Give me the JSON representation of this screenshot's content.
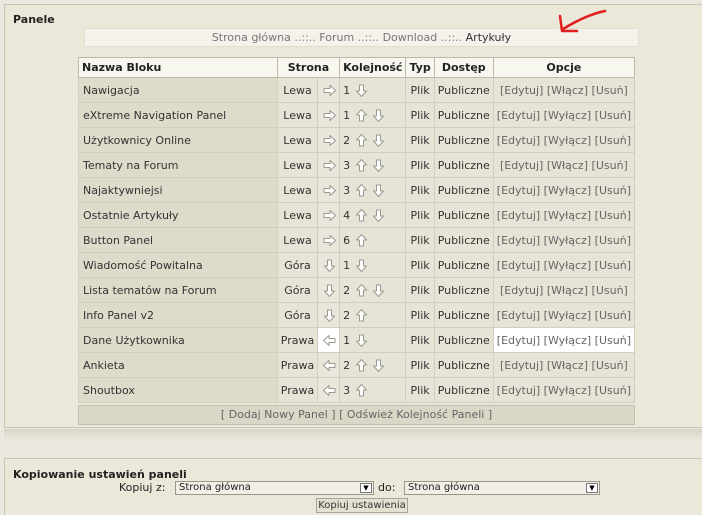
{
  "panel": {
    "title": "Panele"
  },
  "breadcrumb": {
    "home": "Strona główna",
    "sep1": "..::..",
    "forum": "Forum",
    "sep2": "..::..",
    "download": "Download",
    "sep3": "..::..",
    "current": "Artykuły"
  },
  "table": {
    "headers": {
      "name": "Nazwa Bloku",
      "side": "Strona",
      "order": "Kolejność",
      "type": "Typ",
      "access": "Dostęp",
      "options": "Opcje"
    },
    "rows": [
      {
        "name": "Nawigacja",
        "side": "Lewa",
        "move": "right",
        "order": "1",
        "up": false,
        "down": true,
        "type": "Plik",
        "access": "Publiczne",
        "edit": "Edytuj",
        "toggle": "Włącz",
        "delete": "Usuń"
      },
      {
        "name": "eXtreme Navigation Panel",
        "side": "Lewa",
        "move": "right",
        "order": "1",
        "up": true,
        "down": true,
        "type": "Plik",
        "access": "Publiczne",
        "edit": "Edytuj",
        "toggle": "Wyłącz",
        "delete": "Usuń"
      },
      {
        "name": "Użytkownicy Online",
        "side": "Lewa",
        "move": "right",
        "order": "2",
        "up": true,
        "down": true,
        "type": "Plik",
        "access": "Publiczne",
        "edit": "Edytuj",
        "toggle": "Wyłącz",
        "delete": "Usuń"
      },
      {
        "name": "Tematy na Forum",
        "side": "Lewa",
        "move": "right",
        "order": "3",
        "up": true,
        "down": true,
        "type": "Plik",
        "access": "Publiczne",
        "edit": "Edytuj",
        "toggle": "Włącz",
        "delete": "Usuń"
      },
      {
        "name": "Najaktywniejsi",
        "side": "Lewa",
        "move": "right",
        "order": "3",
        "up": true,
        "down": true,
        "type": "Plik",
        "access": "Publiczne",
        "edit": "Edytuj",
        "toggle": "Wyłącz",
        "delete": "Usuń"
      },
      {
        "name": "Ostatnie Artykuły",
        "side": "Lewa",
        "move": "right",
        "order": "4",
        "up": true,
        "down": true,
        "type": "Plik",
        "access": "Publiczne",
        "edit": "Edytuj",
        "toggle": "Wyłącz",
        "delete": "Usuń"
      },
      {
        "name": "Button Panel",
        "side": "Lewa",
        "move": "right",
        "order": "6",
        "up": true,
        "down": false,
        "type": "Plik",
        "access": "Publiczne",
        "edit": "Edytuj",
        "toggle": "Wyłącz",
        "delete": "Usuń"
      },
      {
        "name": "Wiadomość Powitalna",
        "side": "Góra",
        "move": "down",
        "order": "1",
        "up": false,
        "down": true,
        "type": "Plik",
        "access": "Publiczne",
        "edit": "Edytuj",
        "toggle": "Wyłącz",
        "delete": "Usuń"
      },
      {
        "name": "Lista tematów na Forum",
        "side": "Góra",
        "move": "down",
        "order": "2",
        "up": true,
        "down": true,
        "type": "Plik",
        "access": "Publiczne",
        "edit": "Edytuj",
        "toggle": "Włącz",
        "delete": "Usuń"
      },
      {
        "name": "Info Panel v2",
        "side": "Góra",
        "move": "down",
        "order": "2",
        "up": true,
        "down": false,
        "type": "Plik",
        "access": "Publiczne",
        "edit": "Edytuj",
        "toggle": "Wyłącz",
        "delete": "Usuń"
      },
      {
        "name": "Dane Użytkownika",
        "side": "Prawa",
        "move": "left",
        "order": "1",
        "up": false,
        "down": true,
        "type": "Plik",
        "access": "Publiczne",
        "edit": "Edytuj",
        "toggle": "Wyłącz",
        "delete": "Usuń"
      },
      {
        "name": "Ankieta",
        "side": "Prawa",
        "move": "left",
        "order": "2",
        "up": true,
        "down": true,
        "type": "Plik",
        "access": "Publiczne",
        "edit": "Edytuj",
        "toggle": "Włącz",
        "delete": "Usuń"
      },
      {
        "name": "Shoutbox",
        "side": "Prawa",
        "move": "left",
        "order": "3",
        "up": true,
        "down": false,
        "type": "Plik",
        "access": "Publiczne",
        "edit": "Edytuj",
        "toggle": "Wyłącz",
        "delete": "Usuń"
      }
    ]
  },
  "footer_links": {
    "add": "Dodaj Nowy Panel",
    "refresh": "Odśwież Kolejność Paneli"
  },
  "copy_settings": {
    "title": "Kopiowanie ustawień paneli",
    "from_label": "Kopiuj z:",
    "from_value": "Strona główna",
    "to_label": "do:",
    "to_value": "Strona główna",
    "button": "Kopiuj ustawienia"
  }
}
